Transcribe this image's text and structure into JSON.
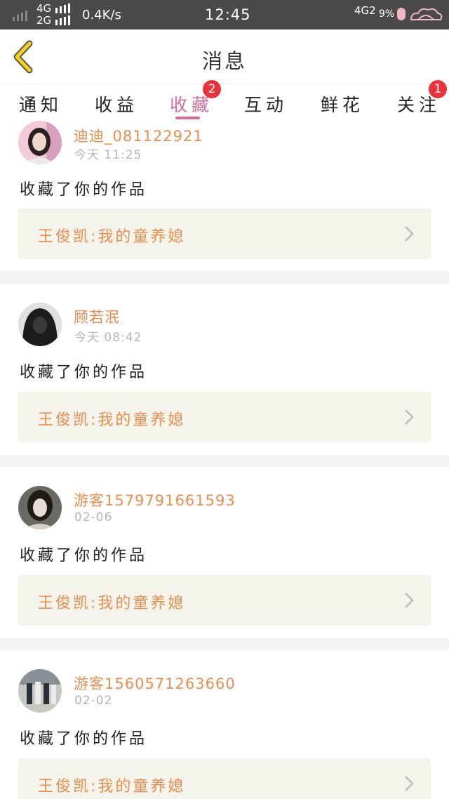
{
  "status_bar": {
    "net_top": "4G",
    "net_bottom": "2G",
    "speed": "0.4K/s",
    "time": "12:45",
    "net_right": "4G2",
    "battery": "9%"
  },
  "nav": {
    "title": "消息"
  },
  "tabs": [
    {
      "label": "通知",
      "active": false
    },
    {
      "label": "收益",
      "active": false
    },
    {
      "label": "收藏",
      "active": true,
      "badge": "2"
    },
    {
      "label": "互动",
      "active": false
    },
    {
      "label": "鲜花",
      "active": false
    },
    {
      "label": "关注",
      "active": false,
      "badge": "1"
    }
  ],
  "messages": [
    {
      "user": "迪迪_081122921",
      "time": "今天 11:25",
      "action": "收藏了你的作品",
      "work": "王俊凯:我的童养媳",
      "avatar_icon": "avatar-girl-pink"
    },
    {
      "user": "顾若泯",
      "time": "今天 08:42",
      "action": "收藏了你的作品",
      "work": "王俊凯:我的童养媳",
      "avatar_icon": "avatar-hooded-dark"
    },
    {
      "user": "游客1579791661593",
      "time": "02-06",
      "action": "收藏了你的作品",
      "work": "王俊凯:我的童养媳",
      "avatar_icon": "avatar-girl-dark"
    },
    {
      "user": "游客1560571263660",
      "time": "02-02",
      "action": "收藏了你的作品",
      "work": "王俊凯:我的童养媳",
      "avatar_icon": "avatar-group-outdoor"
    }
  ],
  "colors": {
    "accent_pink": "#d36c9c",
    "username_orange": "#e98e4e",
    "badge_red": "#e8323c",
    "back_arrow_yellow": "#f2d21b"
  }
}
